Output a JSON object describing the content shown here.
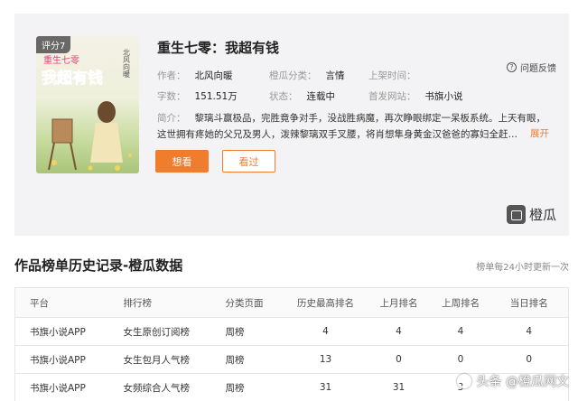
{
  "book": {
    "score_badge": "评分7",
    "cover_title_art": "我超有钱",
    "cover_subtitle_art": "重生七零",
    "cover_author_art": "北风向暖",
    "title": "重生七零：我超有钱",
    "feedback_label": "问题反馈",
    "author_label": "作者：",
    "author": "北风向暖",
    "category_label": "橙瓜分类：",
    "category": "言情",
    "listed_label": "上架时间：",
    "listed": "",
    "words_label": "字数：",
    "words": "151.51万",
    "status_label": "状态：",
    "status": "连载中",
    "site_label": "首发网站：",
    "site": "书旗小说",
    "intro_label": "简介：",
    "intro": "黎璃斗赢极品，完胜竟争对手，没战胜病魔，再次睁眼绑定一呆板系统。上天有眼，这世拥有疼她的父兄及男人，泼辣黎璃双手叉腰，将肖想隼身黄金汉爸爸的寡妇全赶…",
    "expand_label": "展开",
    "want_button": "想看",
    "seen_button": "看过",
    "brand": "橙瓜"
  },
  "history": {
    "title": "作品榜单历史记录-橙瓜数据",
    "note": "榜单每24小时更新一次",
    "columns": [
      "平台",
      "排行榜",
      "分类页面",
      "历史最高排名",
      "上月排名",
      "上周排名",
      "当日排名"
    ],
    "rows": [
      [
        "书旗小说APP",
        "女生原创订阅榜",
        "周榜",
        "4",
        "4",
        "4",
        "4"
      ],
      [
        "书旗小说APP",
        "女生包月人气榜",
        "周榜",
        "13",
        "0",
        "0",
        "0"
      ],
      [
        "书旗小说APP",
        "女频综合人气榜",
        "周榜",
        "31",
        "31",
        "3",
        ""
      ]
    ]
  },
  "watermark": "头条 @橙瓜网文",
  "colors": {
    "accent": "#f07c2e",
    "card_bg": "#f3f3f5"
  }
}
